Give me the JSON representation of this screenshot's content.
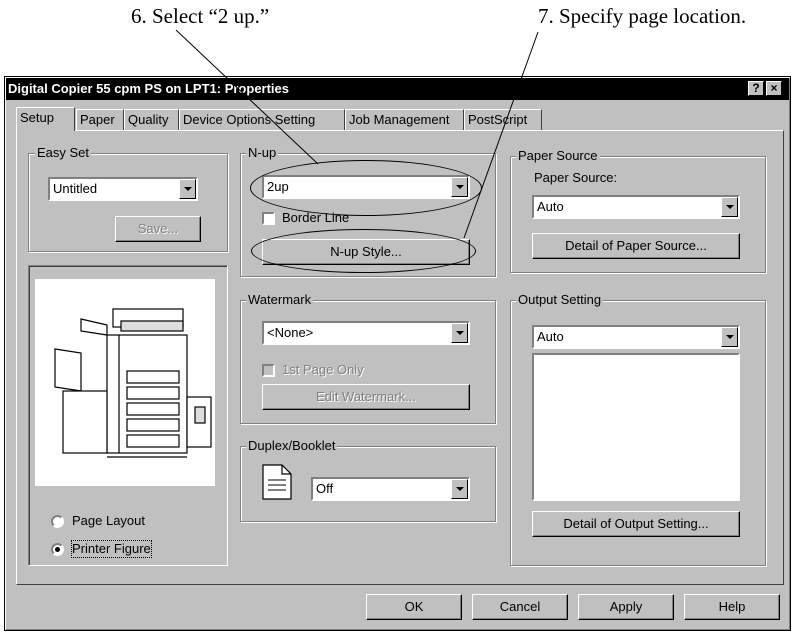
{
  "callouts": {
    "step6": "6. Select “2 up.”",
    "step7": "7. Specify page location."
  },
  "window": {
    "title": "Digital Copier 55 cpm PS on LPT1: Properties",
    "help_btn": "?",
    "close_btn": "×"
  },
  "tabs": [
    {
      "label": "Setup",
      "active": true
    },
    {
      "label": "Paper",
      "active": false
    },
    {
      "label": "Quality",
      "active": false
    },
    {
      "label": "Device Options Setting",
      "active": false
    },
    {
      "label": "Job Management",
      "active": false
    },
    {
      "label": "PostScript",
      "active": false
    }
  ],
  "easy_set": {
    "label": "Easy Set",
    "value": "Untitled",
    "save_label": "Save..."
  },
  "preview": {
    "icon": "printer-figure-image",
    "page_layout_label": "Page Layout",
    "printer_figure_label": "Printer Figure",
    "selected": "Printer Figure"
  },
  "nup": {
    "label": "N-up",
    "value": "2up",
    "border_line_label": "Border Line",
    "border_line_checked": false,
    "style_button": "N-up Style..."
  },
  "watermark": {
    "label": "Watermark",
    "value": "<None>",
    "first_page_only_label": "1st Page Only",
    "edit_button": "Edit Watermark..."
  },
  "duplex": {
    "label": "Duplex/Booklet",
    "icon": "document-icon",
    "value": "Off"
  },
  "paper_source": {
    "group_label": "Paper Source",
    "field_label": "Paper Source:",
    "value": "Auto",
    "detail_button": "Detail of Paper Source..."
  },
  "output_setting": {
    "label": "Output Setting",
    "value": "Auto",
    "detail_button": "Detail of Output Setting..."
  },
  "footer": {
    "ok": "OK",
    "cancel": "Cancel",
    "apply": "Apply",
    "help": "Help"
  }
}
